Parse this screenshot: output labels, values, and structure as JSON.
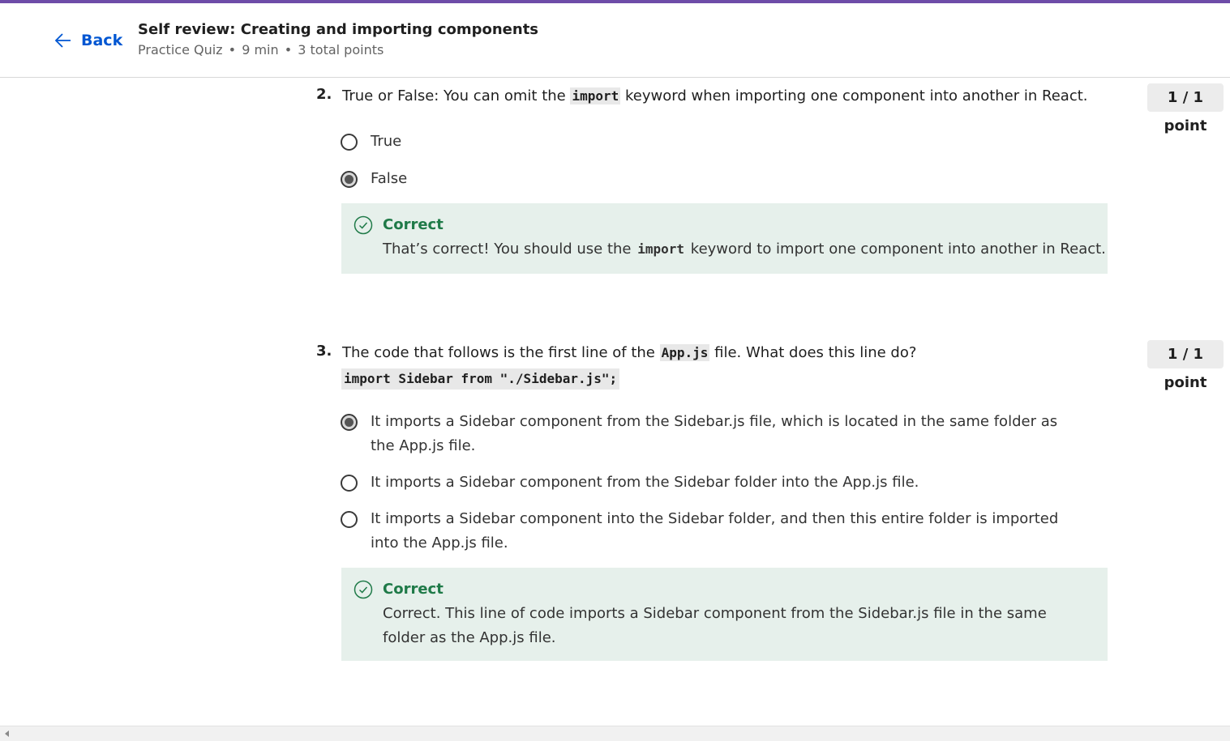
{
  "header": {
    "back_label": "Back",
    "title": "Self review: Creating and importing components",
    "meta": {
      "type": "Practice Quiz",
      "duration": "9 min",
      "points": "3 total points"
    }
  },
  "questions": [
    {
      "number": "2.",
      "text_before": "True or False: You can omit the",
      "code": "import",
      "text_after": "keyword when importing one component into another in React.",
      "points": "1 / 1 point",
      "options": [
        {
          "label": "True",
          "selected": false
        },
        {
          "label": "False",
          "selected": true
        }
      ],
      "feedback": {
        "title": "Correct",
        "text_before": "That’s correct! You should use the",
        "code": "import",
        "text_after": "keyword to import one component into another in React."
      }
    },
    {
      "number": "3.",
      "text_before": "The code that follows is the first line of the",
      "code": "App.js",
      "text_after": "file. What does this line do?",
      "code_line": "import Sidebar from \"./Sidebar.js\";",
      "points": "1 / 1 point",
      "options": [
        {
          "label": "It imports a Sidebar component from the Sidebar.js file, which is located in the same folder as the App.js file.",
          "selected": true
        },
        {
          "label": "It imports a Sidebar component from the Sidebar folder into the App.js file.",
          "selected": false
        },
        {
          "label": "It imports a Sidebar component into the Sidebar folder, and then this entire folder is imported into the App.js file.",
          "selected": false
        }
      ],
      "feedback": {
        "title": "Correct",
        "text": "Correct. This line of code imports a Sidebar component from the Sidebar.js file in the same folder as the App.js file."
      }
    }
  ],
  "colors": {
    "accent": "#0056d2",
    "brand_bar": "#6e4ca8",
    "correct_green": "#1f7a48",
    "feedback_bg": "#e6f0eb"
  }
}
